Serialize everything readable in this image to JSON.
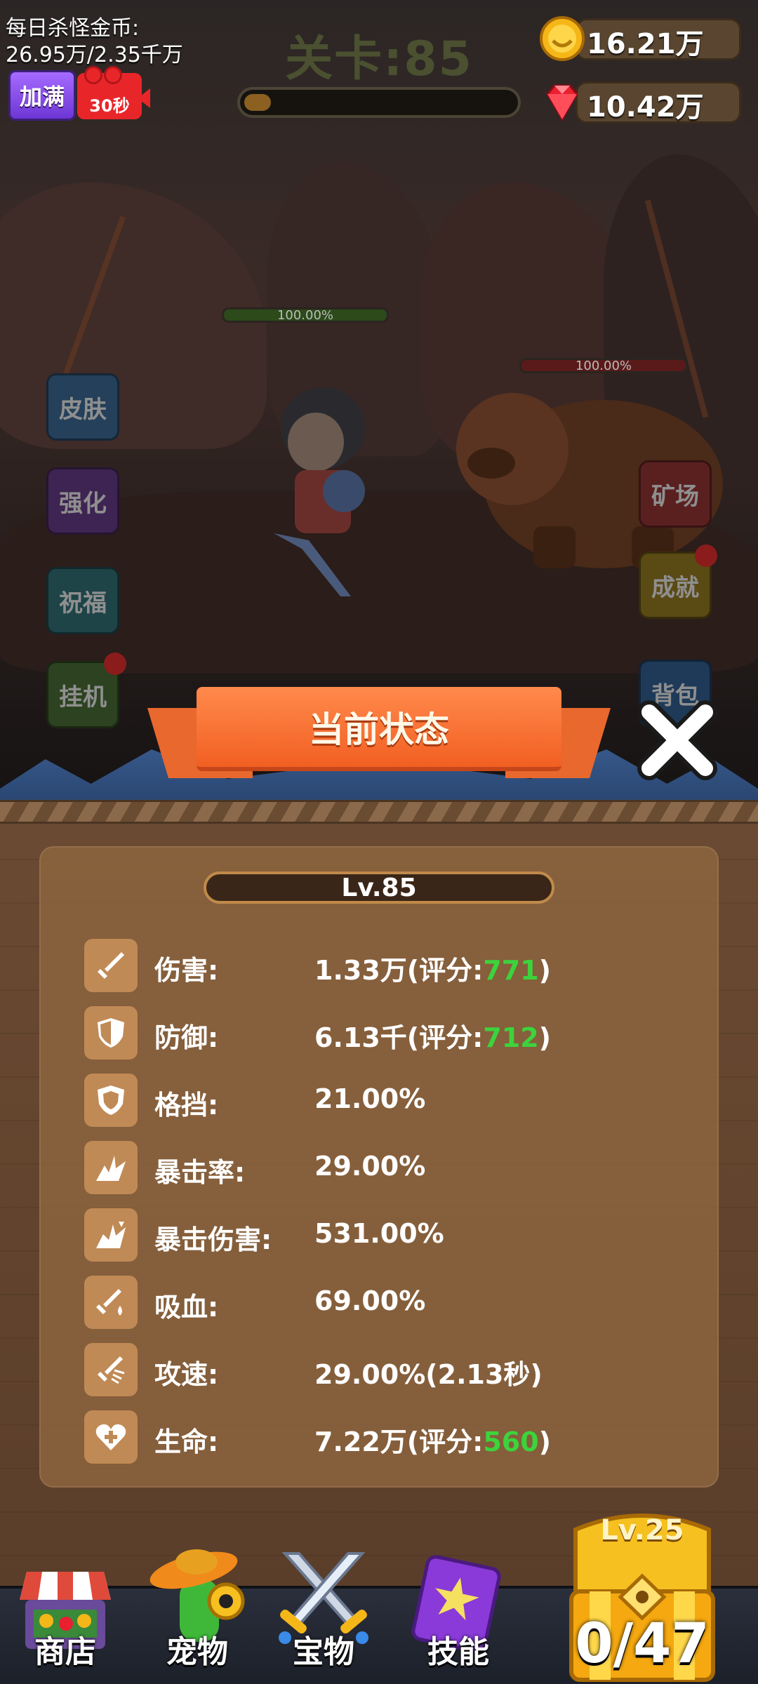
{
  "hud": {
    "kill_coins_label": "每日杀怪金币:",
    "kill_coins_value": "26.95万/2.35千万",
    "fill_button": "加满",
    "video_timer": "30秒"
  },
  "stage": {
    "title": "关卡:85",
    "progress": 0.1
  },
  "currency": {
    "gold": "16.21万",
    "gems": "10.42万"
  },
  "battle": {
    "hero_hp": "100.00%",
    "enemy_hp": "100.00%"
  },
  "side_menu": {
    "left": [
      "皮肤",
      "强化",
      "祝福",
      "挂机"
    ],
    "right": [
      "矿场",
      "成就",
      "背包"
    ]
  },
  "status_panel": {
    "title": "当前状态",
    "level": "Lv.85",
    "stats": [
      {
        "label": "伤害:",
        "value": "1.33万(评分:",
        "score": "771",
        "suffix": ")",
        "icon": "sword-icon"
      },
      {
        "label": "防御:",
        "value": "6.13千(评分:",
        "score": "712",
        "suffix": ")",
        "icon": "shield-icon"
      },
      {
        "label": "格挡:",
        "value": "21.00%",
        "score": "",
        "suffix": "",
        "icon": "block-shield-icon"
      },
      {
        "label": "暴击率:",
        "value": "29.00%",
        "score": "",
        "suffix": "",
        "icon": "crit-burst-icon"
      },
      {
        "label": "暴击伤害:",
        "value": "531.00%",
        "score": "",
        "suffix": "",
        "icon": "crit-damage-icon"
      },
      {
        "label": "吸血:",
        "value": "69.00%",
        "score": "",
        "suffix": "",
        "icon": "lifesteal-icon"
      },
      {
        "label": "攻速:",
        "value": "29.00%(2.13秒)",
        "score": "",
        "suffix": "",
        "icon": "attack-speed-icon"
      },
      {
        "label": "生命:",
        "value": "7.22万(评分:",
        "score": "560",
        "suffix": ")",
        "icon": "heart-plus-icon"
      }
    ]
  },
  "bottom_nav": {
    "shop": "商店",
    "pets": "宠物",
    "treasure": "宝物",
    "skills": "技能",
    "chest_level": "Lv.25",
    "chest_count": "0/47"
  },
  "colors": {
    "ribbon": "#f25f22",
    "score_green": "#3cd33c",
    "panel": "#6b4a32"
  }
}
